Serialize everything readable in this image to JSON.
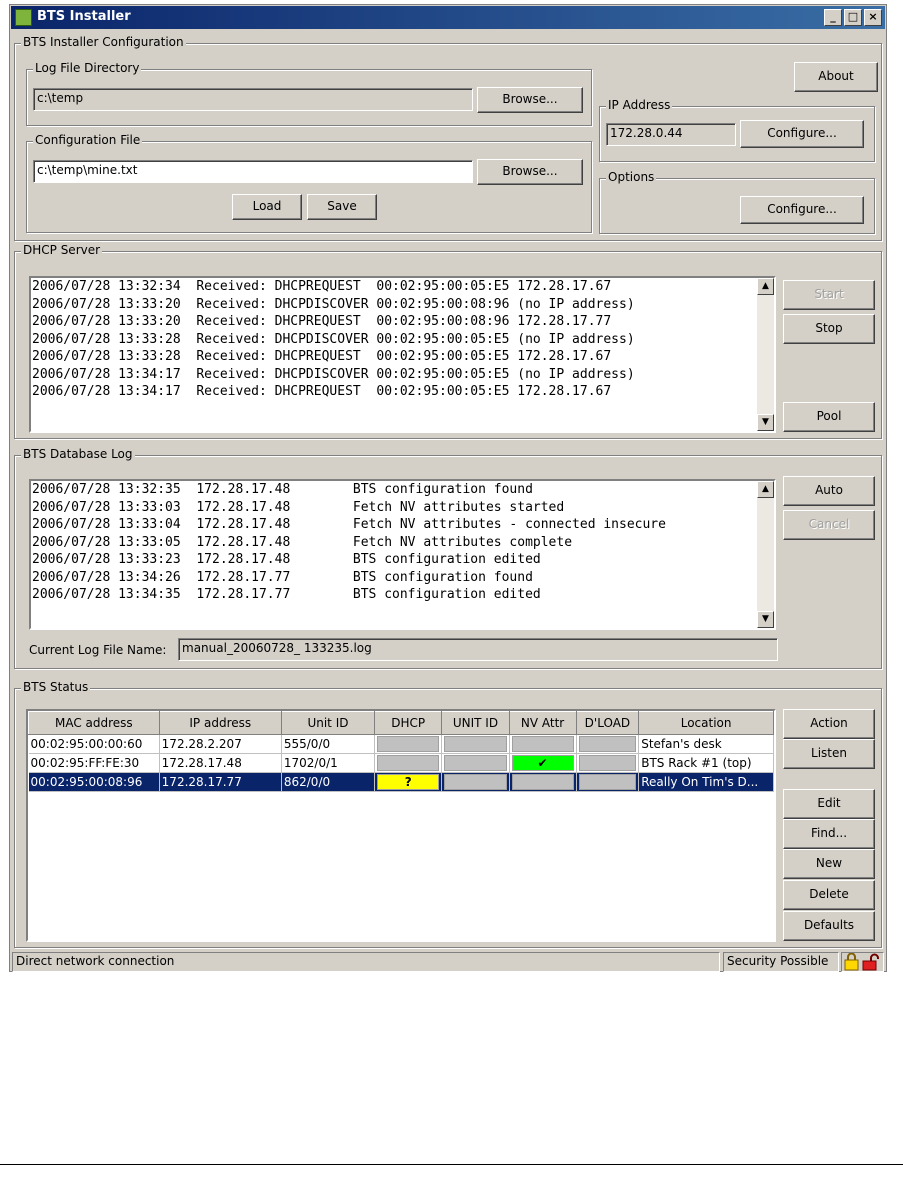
{
  "window": {
    "title": "BTS Installer"
  },
  "config": {
    "group_label": "BTS Installer Configuration",
    "logdir": {
      "label": "Log File Directory",
      "value": "c:\\temp",
      "browse": "Browse..."
    },
    "cfgfile": {
      "label": "Configuration File",
      "value": "c:\\temp\\mine.txt",
      "browse": "Browse..."
    },
    "load": "Load",
    "save": "Save",
    "about": "About",
    "ip": {
      "label": "IP Address",
      "value": "172.28.0.44",
      "configure": "Configure..."
    },
    "options": {
      "label": "Options",
      "configure": "Configure..."
    }
  },
  "dhcp": {
    "label": "DHCP Server",
    "lines": [
      "2006/07/28 13:32:34  Received: DHCPREQUEST  00:02:95:00:05:E5 172.28.17.67",
      "2006/07/28 13:33:20  Received: DHCPDISCOVER 00:02:95:00:08:96 (no IP address)",
      "2006/07/28 13:33:20  Received: DHCPREQUEST  00:02:95:00:08:96 172.28.17.77",
      "2006/07/28 13:33:28  Received: DHCPDISCOVER 00:02:95:00:05:E5 (no IP address)",
      "2006/07/28 13:33:28  Received: DHCPREQUEST  00:02:95:00:05:E5 172.28.17.67",
      "2006/07/28 13:34:17  Received: DHCPDISCOVER 00:02:95:00:05:E5 (no IP address)",
      "2006/07/28 13:34:17  Received: DHCPREQUEST  00:02:95:00:05:E5 172.28.17.67"
    ],
    "start": "Start",
    "stop": "Stop",
    "pool": "Pool"
  },
  "dblog": {
    "label": "BTS Database Log",
    "lines": [
      "2006/07/28 13:32:35  172.28.17.48        BTS configuration found",
      "2006/07/28 13:33:03  172.28.17.48        Fetch NV attributes started",
      "2006/07/28 13:33:04  172.28.17.48        Fetch NV attributes - connected insecure",
      "2006/07/28 13:33:05  172.28.17.48        Fetch NV attributes complete",
      "2006/07/28 13:33:23  172.28.17.48        BTS configuration edited",
      "2006/07/28 13:34:26  172.28.17.77        BTS configuration found",
      "2006/07/28 13:34:35  172.28.17.77        BTS configuration edited"
    ],
    "auto": "Auto",
    "cancel": "Cancel",
    "current_label": "Current Log File Name:",
    "current_value": "manual_20060728_ 133235.log"
  },
  "status": {
    "label": "BTS Status",
    "columns": [
      "MAC address",
      "IP address",
      "Unit ID",
      "DHCP",
      "UNIT ID",
      "NV Attr",
      "D'LOAD",
      "Location"
    ],
    "rows": [
      {
        "mac": "00:02:95:00:00:60",
        "ip": "172.28.2.207",
        "unit": "555/0/0",
        "dhcp": "",
        "unitid": "",
        "nv": "",
        "dload": "",
        "location": "Stefan's desk"
      },
      {
        "mac": "00:02:95:FF:FE:30",
        "ip": "172.28.17.48",
        "unit": "1702/0/1",
        "dhcp": "",
        "unitid": "",
        "nv": "✔",
        "dload": "",
        "location": "BTS Rack #1 (top)"
      },
      {
        "mac": "00:02:95:00:08:96",
        "ip": "172.28.17.77",
        "unit": "862/0/0",
        "dhcp": "?",
        "unitid": "",
        "nv": "",
        "dload": "",
        "location": "Really On Tim's D..."
      }
    ],
    "buttons": {
      "action": "Action",
      "listen": "Listen",
      "edit": "Edit",
      "find": "Find...",
      "new": "New",
      "delete": "Delete",
      "defaults": "Defaults"
    }
  },
  "statusbar": {
    "left": "Direct network connection",
    "right": "Security Possible"
  },
  "colors": {
    "nv_ok": "#00ff00",
    "dhcp_pending": "#ffff00",
    "selection": "#0a246a"
  }
}
